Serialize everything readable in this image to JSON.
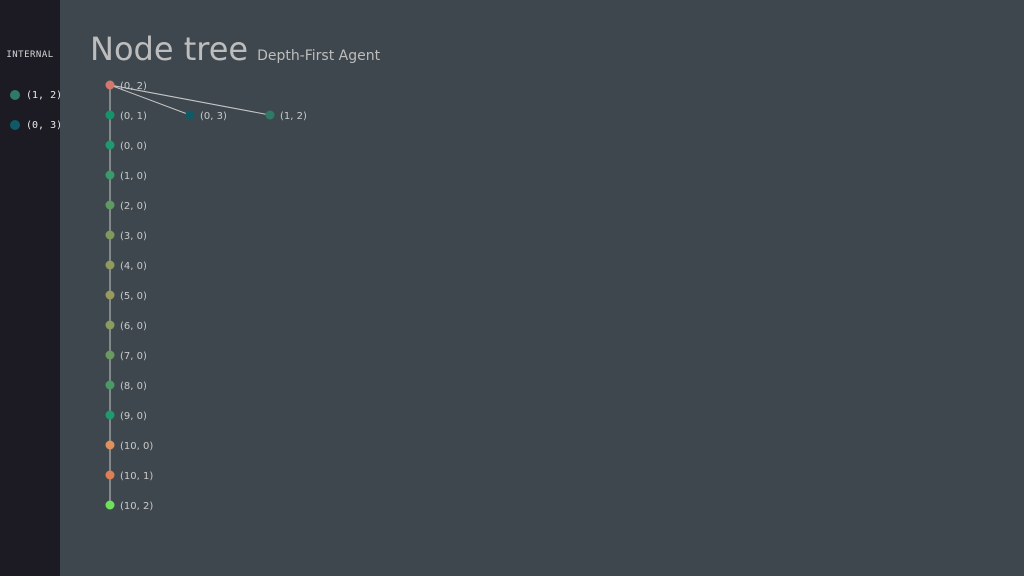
{
  "sidebar": {
    "heading": "INTERNAL",
    "items": [
      {
        "label": "(1, 2)",
        "color": "#2f7a66"
      },
      {
        "label": "(0, 3)",
        "color": "#0f5a66"
      }
    ]
  },
  "header": {
    "title": "Node tree",
    "subtitle": "Depth-First Agent"
  },
  "tree": {
    "nodes": [
      {
        "id": "n02",
        "label": "(0, 2)",
        "color": "#d4776f"
      },
      {
        "id": "n01",
        "label": "(0, 1)",
        "color": "#17936a"
      },
      {
        "id": "n03",
        "label": "(0, 3)",
        "color": "#0f5a66"
      },
      {
        "id": "n12",
        "label": "(1, 2)",
        "color": "#2f7a66"
      },
      {
        "id": "n00",
        "label": "(0, 0)",
        "color": "#1f9a6e"
      },
      {
        "id": "n10",
        "label": "(1, 0)",
        "color": "#3a9a6a"
      },
      {
        "id": "n20",
        "label": "(2, 0)",
        "color": "#5e9a62"
      },
      {
        "id": "n30",
        "label": "(3, 0)",
        "color": "#7f9a5c"
      },
      {
        "id": "n40",
        "label": "(4, 0)",
        "color": "#8f9a5c"
      },
      {
        "id": "n50",
        "label": "(5, 0)",
        "color": "#989a5e"
      },
      {
        "id": "n60",
        "label": "(6, 0)",
        "color": "#8a9c5e"
      },
      {
        "id": "n70",
        "label": "(7, 0)",
        "color": "#6a9a62"
      },
      {
        "id": "n80",
        "label": "(8, 0)",
        "color": "#4a9a66"
      },
      {
        "id": "n90",
        "label": "(9, 0)",
        "color": "#1f9a6e"
      },
      {
        "id": "n100",
        "label": "(10, 0)",
        "color": "#e0905c"
      },
      {
        "id": "n101",
        "label": "(10, 1)",
        "color": "#dd7f56"
      },
      {
        "id": "n102",
        "label": "(10, 2)",
        "color": "#6ee05a"
      }
    ],
    "edges": [
      [
        "n02",
        "n01"
      ],
      [
        "n02",
        "n03"
      ],
      [
        "n02",
        "n12"
      ],
      [
        "n01",
        "n00"
      ],
      [
        "n00",
        "n10"
      ],
      [
        "n10",
        "n20"
      ],
      [
        "n20",
        "n30"
      ],
      [
        "n30",
        "n40"
      ],
      [
        "n40",
        "n50"
      ],
      [
        "n50",
        "n60"
      ],
      [
        "n60",
        "n70"
      ],
      [
        "n70",
        "n80"
      ],
      [
        "n80",
        "n90"
      ],
      [
        "n90",
        "n100"
      ],
      [
        "n100",
        "n101"
      ],
      [
        "n101",
        "n102"
      ]
    ]
  }
}
